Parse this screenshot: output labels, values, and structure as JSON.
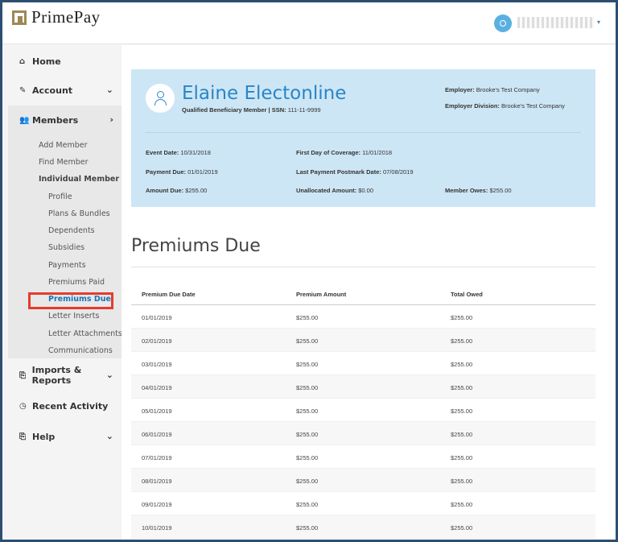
{
  "brand": {
    "name": "PrimePay"
  },
  "header": {
    "user_avatar_icon": "user-icon",
    "user_menu_icon": "caret-down-icon"
  },
  "sidebar": {
    "home": {
      "label": "Home",
      "icon": "home-icon"
    },
    "account": {
      "label": "Account",
      "icon": "pencil-icon"
    },
    "members": {
      "label": "Members",
      "icon": "users-icon",
      "items": {
        "add_member": "Add Member",
        "find_member": "Find Member",
        "individual_member": "Individual Member",
        "profile": "Profile",
        "plans_bundles": "Plans & Bundles",
        "dependents": "Dependents",
        "subsidies": "Subsidies",
        "payments": "Payments",
        "premiums_paid": "Premiums Paid",
        "premiums_due": "Premiums Due",
        "letter_inserts": "Letter Inserts",
        "letter_attachments": "Letter Attachments",
        "communications": "Communications"
      }
    },
    "imports_reports": {
      "label": "Imports & Reports",
      "icon": "clipboard-icon"
    },
    "recent_activity": {
      "label": "Recent Activity",
      "icon": "clock-icon"
    },
    "help": {
      "label": "Help",
      "icon": "clipboard-icon"
    }
  },
  "member": {
    "name": "Elaine Electonline",
    "type_label": "Qualified Beneficiary Member | SSN:",
    "ssn": "111-11-9999",
    "employer_label": "Employer:",
    "employer": "Brooke's Test Company",
    "employer_division_label": "Employer Division:",
    "employer_division": "Brooke's Test Company",
    "event_date_label": "Event Date:",
    "event_date": "10/31/2018",
    "first_day_label": "First Day of Coverage:",
    "first_day": "11/01/2018",
    "payment_due_label": "Payment Due:",
    "payment_due": "01/01/2019",
    "last_payment_label": "Last Payment Postmark Date:",
    "last_payment": "07/08/2019",
    "amount_due_label": "Amount Due:",
    "amount_due": "$255.00",
    "unallocated_label": "Unallocated Amount:",
    "unallocated": "$0.00",
    "member_owes_label": "Member Owes:",
    "member_owes": "$255.00"
  },
  "premiums": {
    "title": "Premiums Due",
    "columns": [
      "Premium Due Date",
      "Premium Amount",
      "Total Owed"
    ],
    "rows": [
      [
        "01/01/2019",
        "$255.00",
        "$255.00"
      ],
      [
        "02/01/2019",
        "$255.00",
        "$255.00"
      ],
      [
        "03/01/2019",
        "$255.00",
        "$255.00"
      ],
      [
        "04/01/2019",
        "$255.00",
        "$255.00"
      ],
      [
        "05/01/2019",
        "$255.00",
        "$255.00"
      ],
      [
        "06/01/2019",
        "$255.00",
        "$255.00"
      ],
      [
        "07/01/2019",
        "$255.00",
        "$255.00"
      ],
      [
        "08/01/2019",
        "$255.00",
        "$255.00"
      ],
      [
        "09/01/2019",
        "$255.00",
        "$255.00"
      ],
      [
        "10/01/2019",
        "$255.00",
        "$255.00"
      ]
    ]
  },
  "colors": {
    "accent": "#2a85c6",
    "card_bg": "#cde6f5",
    "highlight": "#e63b2e",
    "frame": "#2d4e72",
    "logo": "#a08756"
  }
}
